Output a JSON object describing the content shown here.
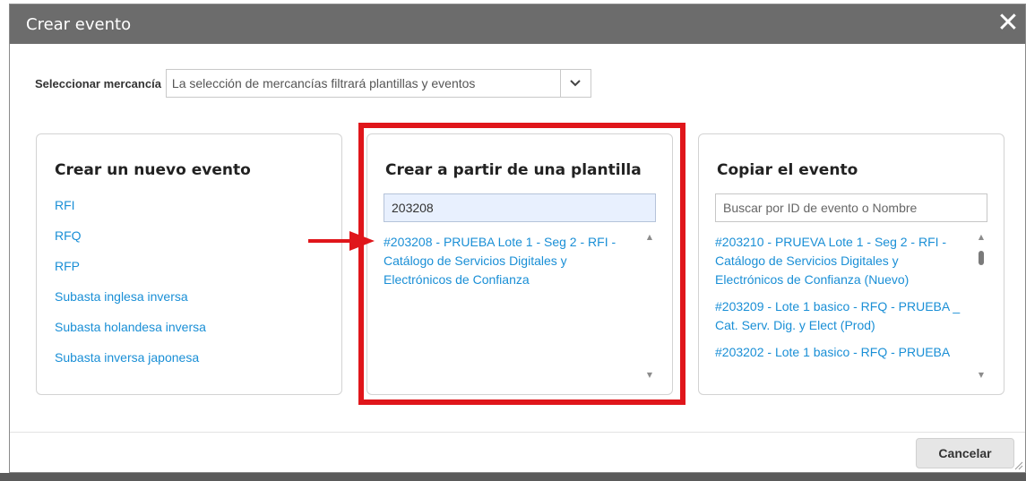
{
  "dialog": {
    "title": "Crear evento",
    "close_icon": "✕"
  },
  "commodity": {
    "label": "Seleccionar mercancía",
    "placeholder": "La selección de mercancías filtrará plantillas y eventos"
  },
  "new_event": {
    "title": "Crear un nuevo evento",
    "items": [
      "RFI",
      "RFQ",
      "RFP",
      "Subasta inglesa inversa",
      "Subasta holandesa inversa",
      "Subasta inversa japonesa"
    ]
  },
  "from_template": {
    "title": "Crear a partir de una plantilla",
    "search_value": "203208",
    "results": [
      "#203208 - PRUEBA Lote 1 - Seg 2 - RFI - Catálogo de Servicios Digitales y Electrónicos de Confianza"
    ]
  },
  "copy_event": {
    "title": "Copiar el evento",
    "search_placeholder": "Buscar por ID de evento o Nombre",
    "results": [
      "#203210 - PRUEVA Lote 1 - Seg 2 - RFI - Catálogo de Servicios Digitales y Electrónicos de Confianza (Nuevo)",
      "#203209 - Lote 1 basico - RFQ - PRUEBA _ Cat. Serv. Dig. y Elect (Prod)",
      "#203202 - Lote 1 basico - RFQ - PRUEBA"
    ]
  },
  "footer": {
    "cancel_label": "Cancelar"
  },
  "colors": {
    "titlebar": "#6c6c6c",
    "link": "#1a8fd6",
    "highlight": "#e0161b"
  }
}
